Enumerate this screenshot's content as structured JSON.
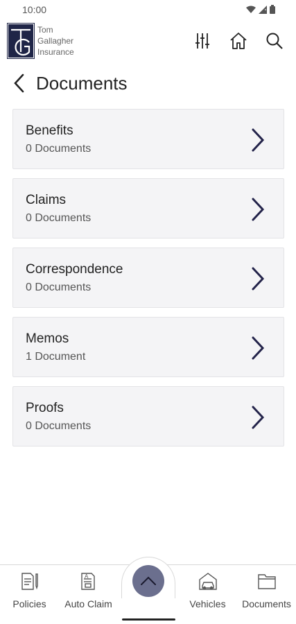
{
  "status_bar": {
    "time": "10:00"
  },
  "header": {
    "logo_lines": [
      "Tom",
      "Gallagher",
      "Insurance"
    ],
    "actions": [
      {
        "name": "filter",
        "icon": "sliders-icon"
      },
      {
        "name": "home",
        "icon": "home-icon"
      },
      {
        "name": "search",
        "icon": "search-icon"
      }
    ]
  },
  "page": {
    "title": "Documents"
  },
  "documents": [
    {
      "name": "Benefits",
      "count": "0 Documents"
    },
    {
      "name": "Claims",
      "count": "0 Documents"
    },
    {
      "name": "Correspondence",
      "count": "0 Documents"
    },
    {
      "name": "Memos",
      "count": "1 Document"
    },
    {
      "name": "Proofs",
      "count": "0 Documents"
    }
  ],
  "bottom_nav": {
    "items": [
      {
        "label": "Policies",
        "icon": "policy-document-icon"
      },
      {
        "label": "Auto Claim",
        "icon": "claim-form-icon"
      },
      {
        "label": "Vehicles",
        "icon": "car-house-icon"
      },
      {
        "label": "Documents",
        "icon": "folder-icon"
      }
    ],
    "fab_icon": "chevron-up-icon"
  },
  "colors": {
    "brand_navy": "#1f2547",
    "fab": "#6b6f8e",
    "card_bg": "#f4f4f6",
    "chevron": "#23234a"
  }
}
